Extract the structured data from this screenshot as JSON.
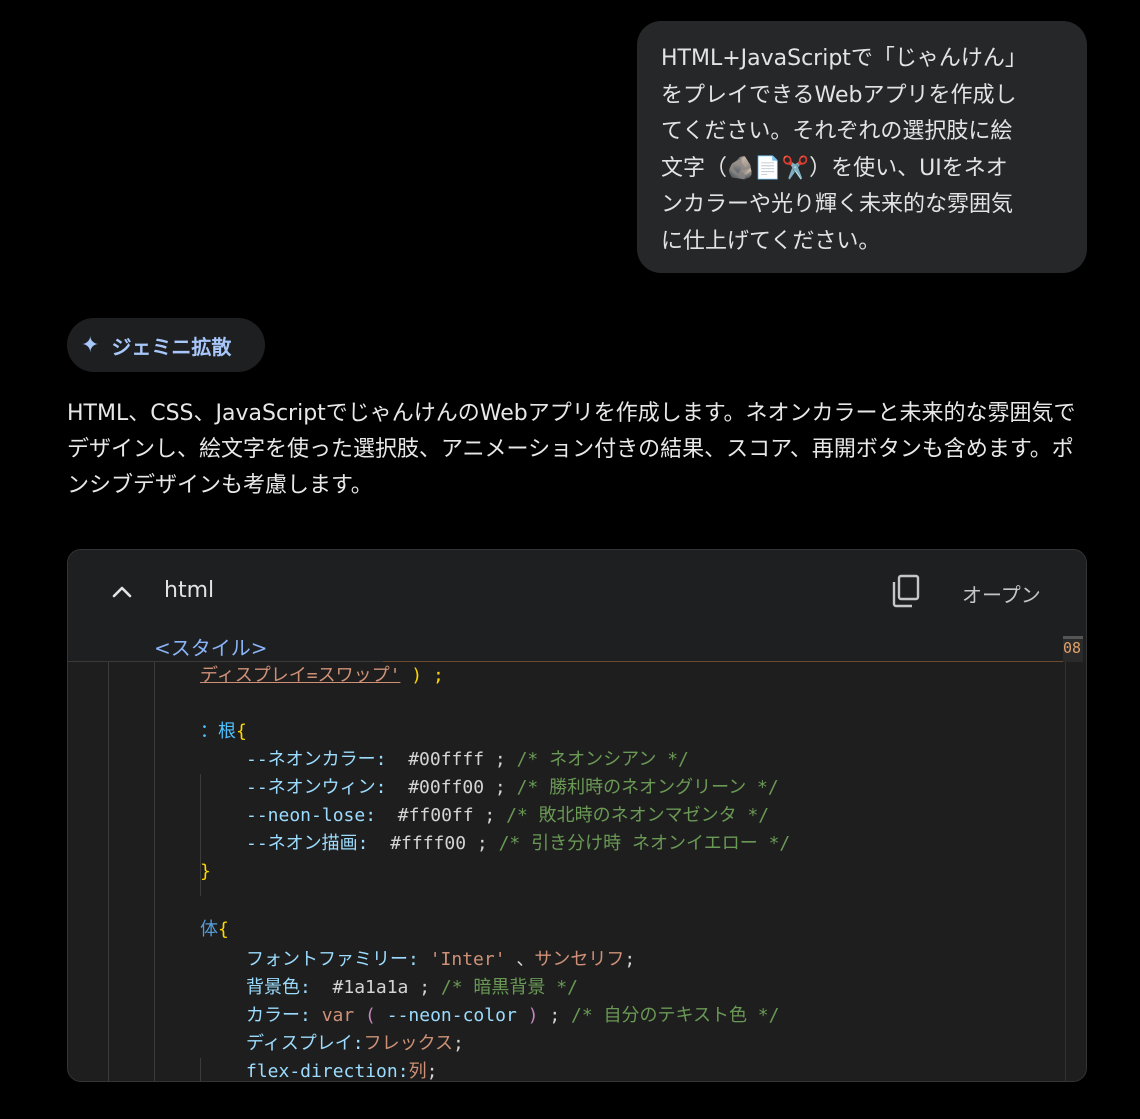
{
  "user_message": "HTML+JavaScriptで「じゃんけん」\nをプレイできるWebアプリを作成し\nてください。それぞれの選択肢に絵\n文字（🪨📄✂️）を使い、UIをネオ\nンカラーや光り輝く未来的な雰囲気\nに仕上げてください。",
  "chip": {
    "label": "ジェミニ拡散",
    "icon": "sparkle-icon"
  },
  "answer": "HTML、CSS、JavaScriptでじゃんけんのWebアプリを作成します。ネオンカラーと未来的な雰囲気でデザインし、絵文字を使った選択肢、アニメーション付きの結果、スコア、再開ボタンも含めます。ポンシブデザインも考慮します。",
  "code_header": {
    "language": "html",
    "open_label": "オープン",
    "sticky_tag": "<スタイル>",
    "edge_text": "08"
  },
  "code": {
    "l1": {
      "str": "ディスプレイ=スワップ'",
      "end": ") ;"
    },
    "l2": {
      "sel": "：根",
      "brace": "{"
    },
    "l3": {
      "prop": "--ネオンカラー:",
      "val": "#00ffff ;",
      "cmt": "/* ネオンシアン */"
    },
    "l4": {
      "prop": "--ネオンウィン:",
      "val": "#00ff00 ;",
      "cmt": "/* 勝利時のネオングリーン */"
    },
    "l5": {
      "prop": "--neon-lose:",
      "val": "#ff00ff ;",
      "cmt": "/* 敗北時のネオンマゼンタ */"
    },
    "l6": {
      "prop": "--ネオン描画:",
      "val": "#ffff00 ;",
      "cmt": "/* 引き分け時 ネオンイエロー */"
    },
    "l7": {
      "brace": "}"
    },
    "l8": {
      "sel": "体",
      "brace": "{"
    },
    "l9": {
      "prop": "フォントファミリー:",
      "str": "'Inter'",
      "punc": "、",
      "str2": "サンセリフ",
      "end": ";"
    },
    "l10": {
      "prop": "背景色:",
      "val": "#1a1a1a ;",
      "cmt": "/* 暗黒背景 */"
    },
    "l11": {
      "prop": "カラー:",
      "fn": "var",
      "paren1": "(",
      "arg": "--neon-color",
      "paren2": ")",
      "end": ";",
      "cmt": "/* 自分のテキスト色 */"
    },
    "l12": {
      "prop": "ディスプレイ:",
      "str": "フレックス",
      "end": ";"
    },
    "l13": {
      "prop": "flex-direction:",
      "str": "列",
      "end": ";"
    }
  }
}
